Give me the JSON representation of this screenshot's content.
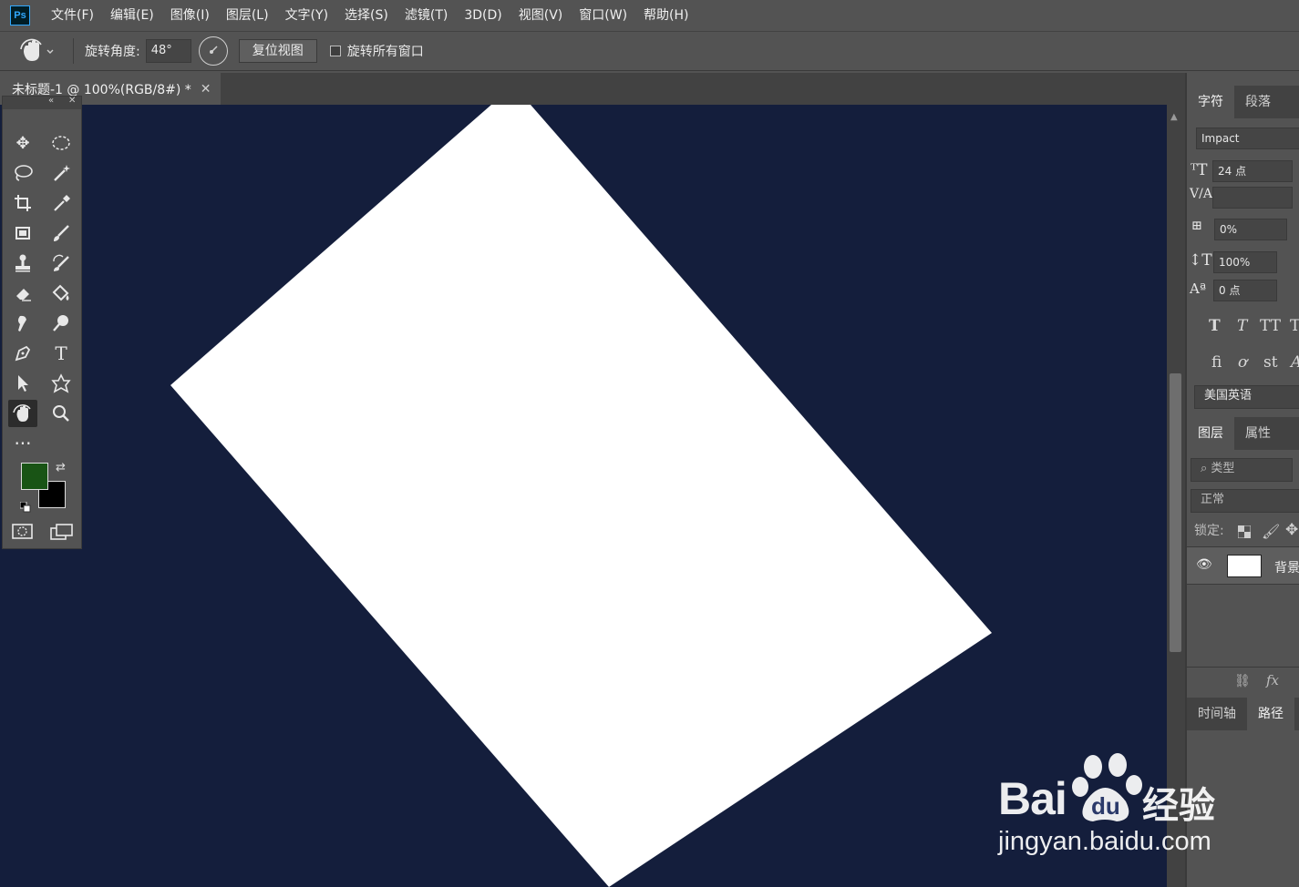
{
  "app": {
    "logo_text": "Ps"
  },
  "menu": [
    "文件(F)",
    "编辑(E)",
    "图像(I)",
    "图层(L)",
    "文字(Y)",
    "选择(S)",
    "滤镜(T)",
    "3D(D)",
    "视图(V)",
    "窗口(W)",
    "帮助(H)"
  ],
  "options": {
    "angle_label": "旋转角度:",
    "angle_value": "48°",
    "reset_label": "复位视图",
    "rotate_all_label": "旋转所有窗口"
  },
  "document": {
    "tab_title": "未标题-1 @ 100%(RGB/8#) *",
    "rotation_degrees": 48
  },
  "colors": {
    "foreground": "#195415",
    "background": "#000000",
    "pasteboard": "#141e3c"
  },
  "character_panel": {
    "tabs": [
      "字符",
      "段落"
    ],
    "font_family": "Impact",
    "font_size": "24 点",
    "tracking": "0%",
    "vertical_scale": "100%",
    "baseline_shift": "0 点",
    "typo_row1": [
      "T",
      "T",
      "TT",
      "T"
    ],
    "typo_row2": [
      "fi",
      "ơ",
      "st",
      "A"
    ],
    "language": "美国英语"
  },
  "layers_panel": {
    "tabs": [
      "图层",
      "属性"
    ],
    "filter_label": "类型",
    "blend_mode": "正常",
    "lock_label": "锁定:",
    "layer_name": "背景"
  },
  "bottom_panel": {
    "tabs": [
      "时间轴",
      "路径"
    ]
  },
  "watermark": {
    "brand": "Bai",
    "brand_du": "du",
    "brand_cn": "经验",
    "url": "jingyan.baidu.com"
  }
}
